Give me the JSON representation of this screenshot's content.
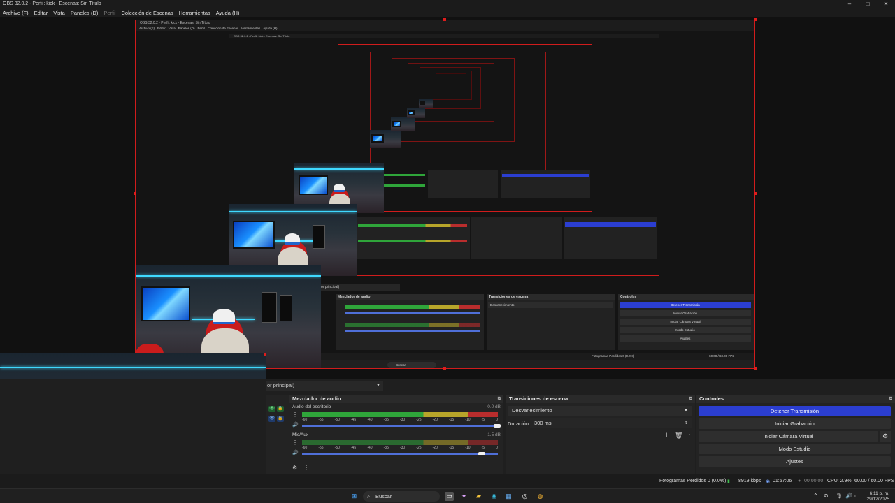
{
  "window": {
    "title": "OBS 32.0.2 - Perfil: kick - Escenas: Sin Título",
    "minimize": "–",
    "maximize": "□",
    "close": "✕"
  },
  "menu": {
    "items": [
      "Archivo (F)",
      "Editar",
      "Vista",
      "Paneles (D)",
      "Perfil",
      "Colección de Escenas",
      "Herramientas",
      "Ayuda (H)"
    ],
    "disabled_index": 4
  },
  "scene_selector": {
    "value": "or principal)"
  },
  "mixer": {
    "title": "Mezclador de audio",
    "channels": [
      {
        "name": "Audio del escritorio",
        "db": "0.0 dB"
      },
      {
        "name": "Mic/Aux",
        "db": "-1.5 dB"
      }
    ],
    "ticks": [
      "-60",
      "-55",
      "-50",
      "-45",
      "-40",
      "-35",
      "-30",
      "-25",
      "-20",
      "-15",
      "-10",
      "-5",
      "0"
    ]
  },
  "transitions": {
    "title": "Transiciones de escena",
    "selected": "Desvanecimiento",
    "duration_label": "Duración",
    "duration_value": "300 ms"
  },
  "controls": {
    "title": "Controles",
    "stop_stream": "Detener Transmisión",
    "start_recording": "Iniciar Grabación",
    "start_virtual_cam": "Iniciar Cámara Virtual",
    "studio_mode": "Modo Estudio",
    "settings": "Ajustes"
  },
  "status": {
    "dropped_frames": "Fotogramas Perdidos 0 (0.0%)",
    "bitrate": "8919 kbps",
    "stream_time": "01:57:06",
    "rec_time": "00:00:00",
    "cpu": "CPU: 2.9%",
    "fps": "60.00 / 60.00 FPS"
  },
  "taskbar": {
    "search_placeholder": "Buscar",
    "time": "6:11 p. m.",
    "date": "29/12/2025"
  },
  "colors": {
    "accent_blue": "#2b3ed1",
    "selection_red": "#d01c1c",
    "meter_green": "#2fa53a",
    "meter_yellow": "#b7a52a",
    "meter_red": "#b92d2d"
  }
}
